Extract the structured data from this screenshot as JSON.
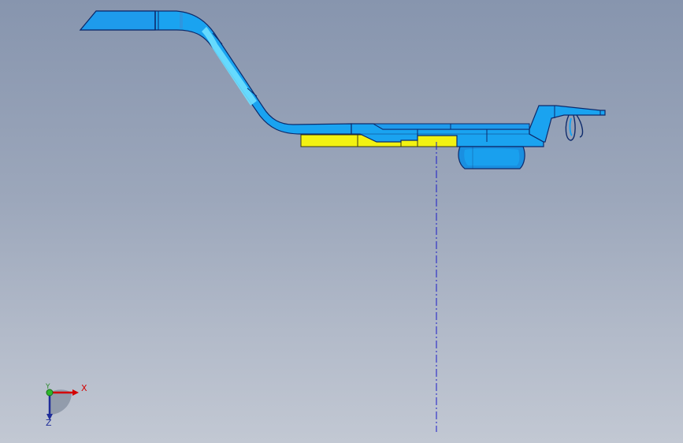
{
  "viewport": {
    "background_top": "#8795ae",
    "background_bottom": "#c2c8d3"
  },
  "part": {
    "body_color": "#1aa3f0",
    "edge_color": "#0d2a6b",
    "highlight_color": "#6fe0ff",
    "base_color": "#f2f212",
    "centerline_color": "#1a1ac8"
  },
  "triad": {
    "x_label": "X",
    "y_label": "Y",
    "z_label": "Z",
    "x_color": "#d40000",
    "y_color": "#2d8a2d",
    "z_color": "#1f2d99"
  }
}
